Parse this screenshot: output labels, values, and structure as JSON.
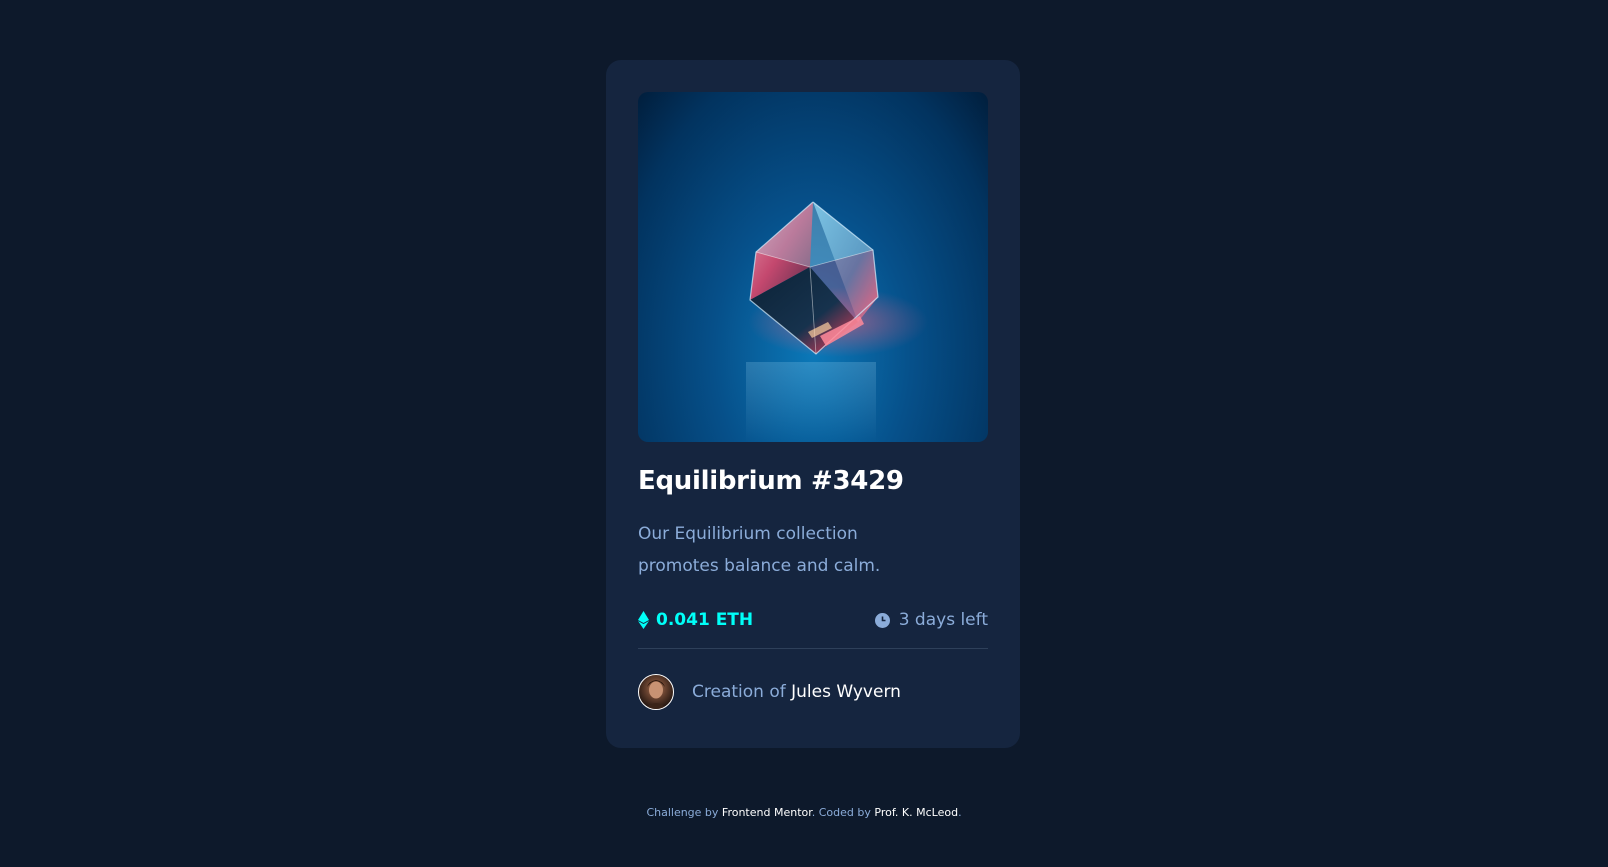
{
  "card": {
    "image_alt": "Equilibrium cube image",
    "title": "Equilibrium #3429",
    "description": "Our Equilibrium collection promotes balance and calm.",
    "price": "0.041 ETH",
    "time_left": "3 days left",
    "creator_prefix": "Creation of ",
    "creator_name": "Jules Wyvern"
  },
  "attribution": {
    "challenge_prefix": "Challenge by ",
    "challenge_link": "Frontend Mentor",
    "coded_prefix": ". Coded by ",
    "coded_link": "Prof. K. McLeod",
    "suffix": "."
  },
  "icons": {
    "price": "ethereum-icon",
    "time": "clock-icon"
  },
  "colors": {
    "page_bg": "#0d192b",
    "card_bg": "#15253f",
    "accent_cyan": "#00fff8",
    "soft_blue": "#8bacd9",
    "white": "#ffffff",
    "divider": "#2e405a"
  }
}
